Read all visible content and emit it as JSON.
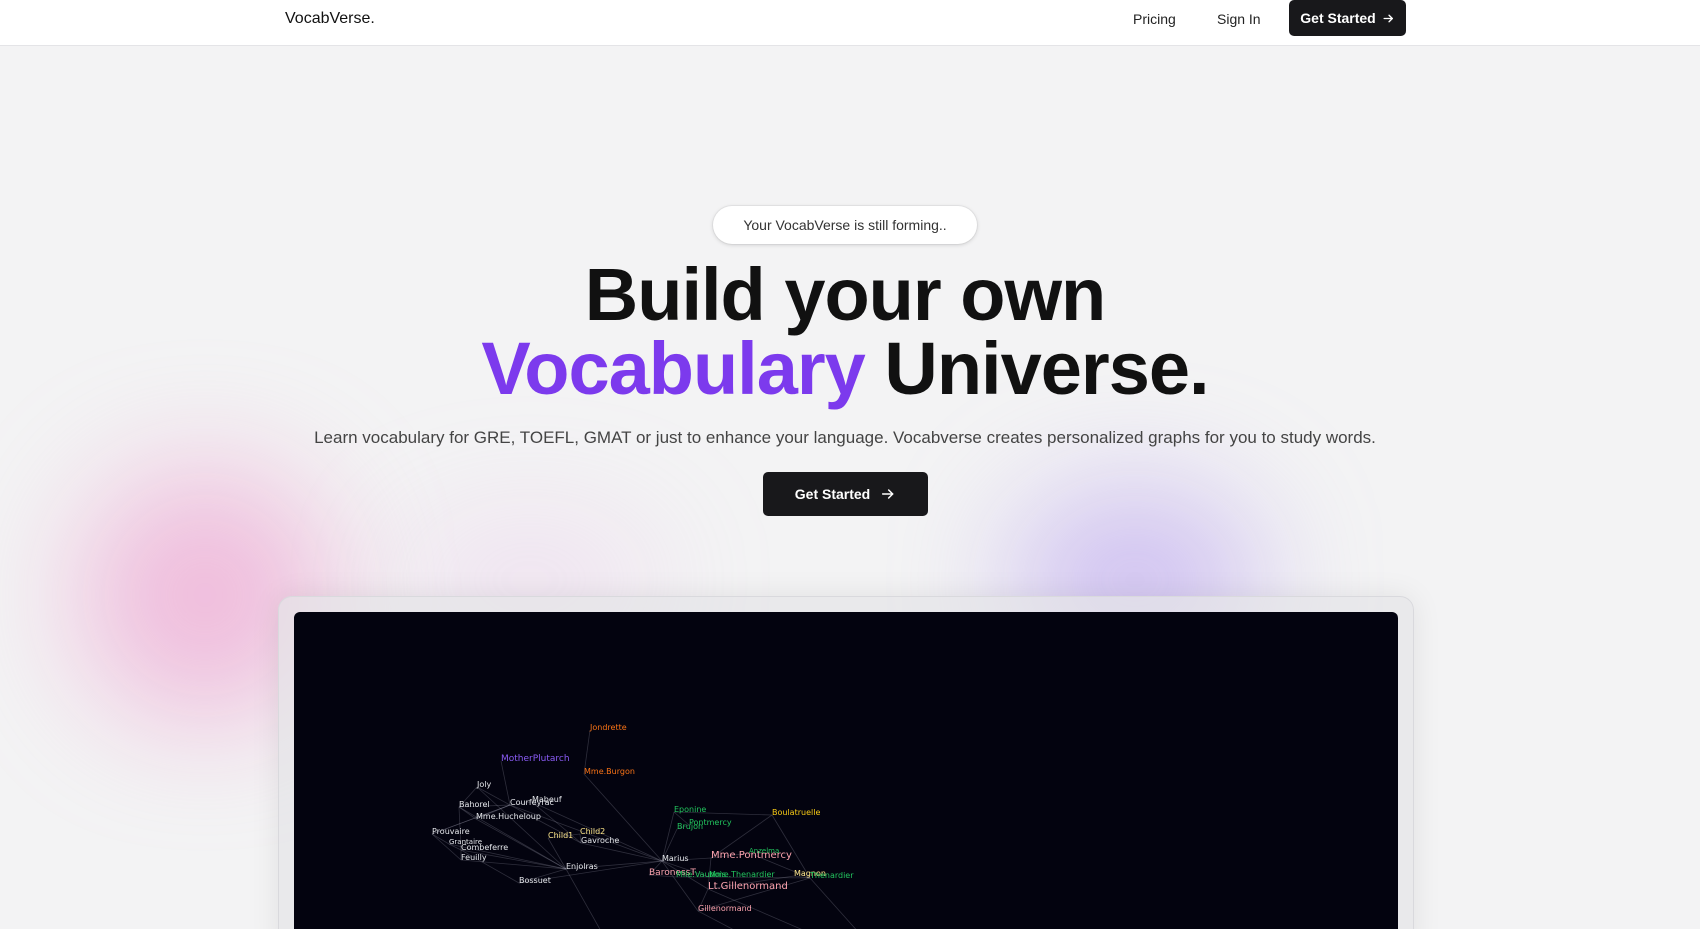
{
  "nav": {
    "brand": "VocabVerse.",
    "pricing": "Pricing",
    "sign_in": "Sign In",
    "cta": "Get Started"
  },
  "hero": {
    "badge": "Your VocabVerse is still forming..",
    "title_line1": "Build your own",
    "title_accent": "Vocabulary",
    "title_rest": "Universe.",
    "subtitle": "Learn vocabulary for GRE, TOEFL, GMAT or just to enhance your language. Vocabverse creates personalized graphs for you to study words.",
    "cta": "Get Started"
  },
  "colors": {
    "accent": "#7c3aed",
    "dark_button": "#18181b",
    "graph_bg": "#03030f"
  },
  "graph": {
    "nodes": [
      {
        "label": "Jondrette",
        "color": "#f97316"
      },
      {
        "label": "MotherPlutarch",
        "color": "#8b5cf6"
      },
      {
        "label": "Mme.Burgon",
        "color": "#f97316"
      },
      {
        "label": "Joly",
        "color": "#e5e7eb"
      },
      {
        "label": "Bahorel",
        "color": "#e5e7eb"
      },
      {
        "label": "Courfeyrac",
        "color": "#e5e7eb"
      },
      {
        "label": "Mabeuf",
        "color": "#e5e7eb"
      },
      {
        "label": "Mme.Hucheloup",
        "color": "#e5e7eb"
      },
      {
        "label": "Eponine",
        "color": "#22c55e"
      },
      {
        "label": "Boulatruelle",
        "color": "#facc15"
      },
      {
        "label": "Pontmercy",
        "color": "#22c55e"
      },
      {
        "label": "Brujon",
        "color": "#22c55e"
      },
      {
        "label": "Prouvaire",
        "color": "#e5e7eb"
      },
      {
        "label": "Child1",
        "color": "#fde68a"
      },
      {
        "label": "Child2",
        "color": "#fde68a"
      },
      {
        "label": "Gavroche",
        "color": "#e5e7eb"
      },
      {
        "label": "Grantaire",
        "color": "#e5e7eb"
      },
      {
        "label": "Combeferre",
        "color": "#e5e7eb"
      },
      {
        "label": "Feuilly",
        "color": "#e5e7eb"
      },
      {
        "label": "Marius",
        "color": "#e5e7eb"
      },
      {
        "label": "Mme.Pontmercy",
        "color": "#fda4af"
      },
      {
        "label": "Anzelma",
        "color": "#22c55e"
      },
      {
        "label": "Enjolras",
        "color": "#e5e7eb"
      },
      {
        "label": "BaronessT",
        "color": "#fda4af"
      },
      {
        "label": "Mlle.Vaubois",
        "color": "#22c55e"
      },
      {
        "label": "Mme.Thenardier",
        "color": "#22c55e"
      },
      {
        "label": "Magnon",
        "color": "#fde68a"
      },
      {
        "label": "Thenardier",
        "color": "#22c55e"
      },
      {
        "label": "Bossuet",
        "color": "#e5e7eb"
      },
      {
        "label": "Lt.Gillenormand",
        "color": "#fda4af"
      },
      {
        "label": "Gillenormand",
        "color": "#fda4af"
      }
    ]
  }
}
